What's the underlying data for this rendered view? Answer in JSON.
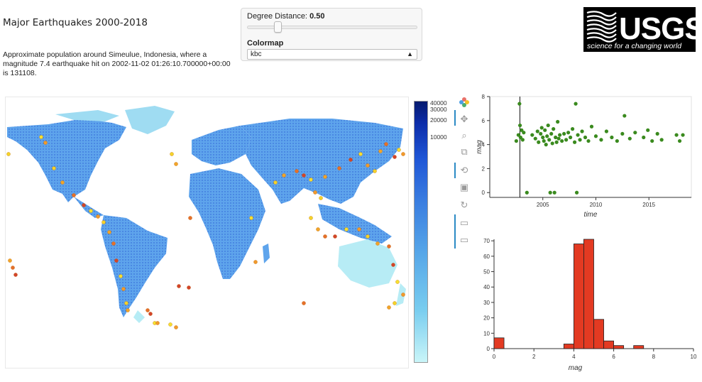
{
  "page": {
    "title": "Major Earthquakes 2000-2018",
    "description": "Approximate population around Simeulue, Indonesia, where a magnitude 7.4 earthquake hit on 2002-11-02 01:26:10.700000+00:00 is 131108."
  },
  "controls": {
    "slider_label": "Degree Distance:",
    "slider_value": "0.50",
    "slider_level": 0.5,
    "colormap_label": "Colormap",
    "colormap_value": "kbc"
  },
  "logo": {
    "name": "USGS",
    "tagline": "science for a changing world"
  },
  "colorbar": {
    "ticks": [
      "40000",
      "30000",
      "20000",
      "10000"
    ]
  },
  "toolbar": {
    "icons": [
      "bokeh-logo-icon",
      "pan-icon",
      "box-zoom-icon",
      "wheel-zoom-icon",
      "lasso-icon",
      "save-icon",
      "reset-icon",
      "hover-icon",
      "hover-icon-2"
    ]
  },
  "colors": {
    "scatter_point": "#3a8a1e",
    "histogram_bar": "#e33a22",
    "eq_marker": "#f0a020"
  },
  "chart_data": [
    {
      "type": "scatter",
      "xlabel": "time",
      "ylabel": "mag",
      "xticks": [
        "2005",
        "2010",
        "2015"
      ],
      "yticks": [
        "0",
        "2",
        "4",
        "6",
        "8"
      ],
      "xlim": [
        2000.0,
        2019.0
      ],
      "ylim": [
        -0.4,
        8.0
      ],
      "vline_x": 2002.84,
      "points": [
        [
          2002.5,
          4.3
        ],
        [
          2002.7,
          4.8
        ],
        [
          2002.8,
          7.4
        ],
        [
          2002.85,
          5.6
        ],
        [
          2002.9,
          4.6
        ],
        [
          2003.0,
          5.2
        ],
        [
          2003.1,
          4.4
        ],
        [
          2003.2,
          5.0
        ],
        [
          2003.5,
          0.0
        ],
        [
          2004.0,
          4.8
        ],
        [
          2004.3,
          4.5
        ],
        [
          2004.5,
          5.1
        ],
        [
          2004.6,
          4.2
        ],
        [
          2004.8,
          4.9
        ],
        [
          2004.9,
          5.4
        ],
        [
          2005.0,
          4.6
        ],
        [
          2005.1,
          4.3
        ],
        [
          2005.2,
          5.2
        ],
        [
          2005.3,
          4.0
        ],
        [
          2005.4,
          4.7
        ],
        [
          2005.5,
          5.6
        ],
        [
          2005.6,
          4.4
        ],
        [
          2005.7,
          0.0
        ],
        [
          2005.8,
          4.9
        ],
        [
          2005.9,
          4.1
        ],
        [
          2006.0,
          5.3
        ],
        [
          2006.1,
          0.0
        ],
        [
          2006.2,
          4.6
        ],
        [
          2006.3,
          4.2
        ],
        [
          2006.4,
          5.9
        ],
        [
          2006.5,
          4.5
        ],
        [
          2006.6,
          4.8
        ],
        [
          2006.8,
          4.3
        ],
        [
          2007.0,
          4.9
        ],
        [
          2007.2,
          4.4
        ],
        [
          2007.4,
          5.0
        ],
        [
          2007.6,
          4.6
        ],
        [
          2007.8,
          5.3
        ],
        [
          2008.0,
          4.2
        ],
        [
          2008.1,
          7.4
        ],
        [
          2008.2,
          0.0
        ],
        [
          2008.3,
          4.8
        ],
        [
          2008.5,
          4.4
        ],
        [
          2008.7,
          5.1
        ],
        [
          2009.0,
          4.6
        ],
        [
          2009.3,
          4.3
        ],
        [
          2009.6,
          5.5
        ],
        [
          2010.0,
          4.7
        ],
        [
          2010.5,
          4.4
        ],
        [
          2011.0,
          5.1
        ],
        [
          2011.5,
          4.6
        ],
        [
          2012.0,
          4.3
        ],
        [
          2012.5,
          4.9
        ],
        [
          2012.7,
          6.4
        ],
        [
          2013.2,
          4.5
        ],
        [
          2013.7,
          5.0
        ],
        [
          2014.5,
          4.6
        ],
        [
          2014.9,
          5.2
        ],
        [
          2015.3,
          4.3
        ],
        [
          2015.8,
          4.9
        ],
        [
          2016.2,
          4.4
        ],
        [
          2017.6,
          4.8
        ],
        [
          2017.9,
          4.3
        ],
        [
          2018.2,
          4.8
        ]
      ]
    },
    {
      "type": "bar",
      "xlabel": "mag",
      "ylabel": "",
      "xticks": [
        "0",
        "2",
        "4",
        "6",
        "8",
        "10"
      ],
      "yticks": [
        "0",
        "10",
        "20",
        "30",
        "40",
        "50",
        "60",
        "70"
      ],
      "xlim": [
        0,
        10
      ],
      "ylim": [
        0,
        71
      ],
      "bin_width": 0.5,
      "bins": [
        {
          "x0": 0.0,
          "count": 7
        },
        {
          "x0": 3.5,
          "count": 3
        },
        {
          "x0": 4.0,
          "count": 68
        },
        {
          "x0": 4.5,
          "count": 71
        },
        {
          "x0": 5.0,
          "count": 19
        },
        {
          "x0": 5.5,
          "count": 5
        },
        {
          "x0": 6.0,
          "count": 2
        },
        {
          "x0": 7.0,
          "count": 2
        }
      ]
    }
  ]
}
